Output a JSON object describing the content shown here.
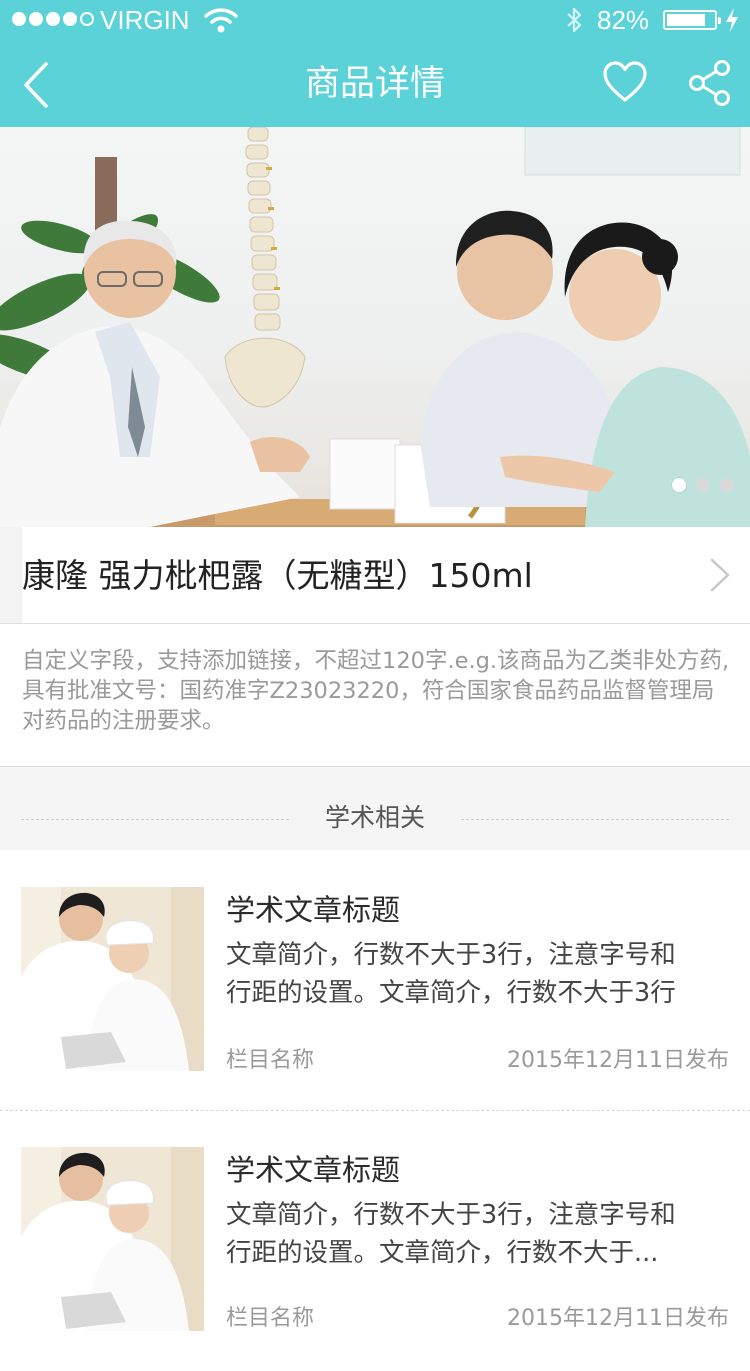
{
  "status_bar": {
    "carrier": "VIRGIN",
    "time": "",
    "battery_percent": "82%",
    "battery_level": 0.82
  },
  "nav": {
    "title": "商品详情",
    "back_icon": "chevron-left-icon",
    "favorite_icon": "heart-icon",
    "share_icon": "share-icon"
  },
  "hero": {
    "slide_count": 3,
    "active_slide": 1
  },
  "product": {
    "name": "康隆 强力枇杷露（无糖型）150ml",
    "description": "自定义字段，支持添加链接，不超过120字.e.g.该商品为乙类非处方药,具有批准文号：国药准字Z23023220，符合国家食品药品监督管理局对药品的注册要求。"
  },
  "section": {
    "title": "学术相关"
  },
  "articles": [
    {
      "title": "学术文章标题",
      "summary": "文章简介，行数不大于3行，注意字号和\n行距的设置。文章简介，行数不大于3行",
      "column": "栏目名称",
      "date": "2015年12月11日发布"
    },
    {
      "title": "学术文章标题",
      "summary": "文章简介，行数不大于3行，注意字号和\n行距的设置。文章简介，行数不大于...",
      "column": "栏目名称",
      "date": "2015年12月11日发布"
    }
  ],
  "colors": {
    "accent": "#5bd1d8",
    "text_primary": "#222222",
    "text_muted": "#9a9a9a",
    "background_band": "#f5f5f5"
  }
}
